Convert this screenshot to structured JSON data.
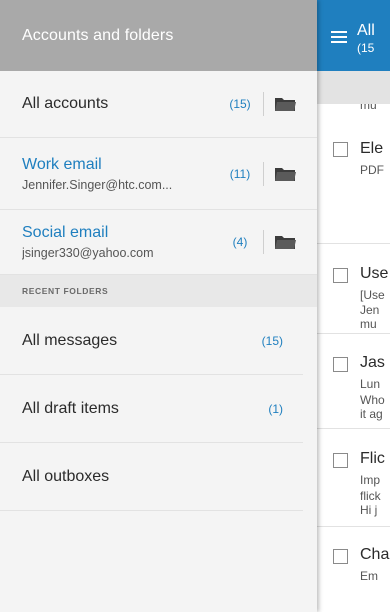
{
  "drawer": {
    "title": "Accounts and folders",
    "accounts": [
      {
        "name": "All accounts",
        "email": "",
        "count": "(15)"
      },
      {
        "name": "Work email",
        "email": "Jennifer.Singer@htc.com...",
        "count": "(11)"
      },
      {
        "name": "Social email",
        "email": "jsinger330@yahoo.com",
        "count": "(4)"
      }
    ],
    "recent_header": "RECENT FOLDERS",
    "folders": [
      {
        "name": "All messages",
        "count": "(15)"
      },
      {
        "name": "All draft items",
        "count": "(1)"
      },
      {
        "name": "All outboxes",
        "count": ""
      }
    ]
  },
  "mail": {
    "title": "All",
    "subtitle": "(15",
    "strip_text": "mu",
    "items": [
      {
        "title": "Ele",
        "lines": [
          "PDF"
        ]
      },
      {
        "title": "Use",
        "lines": [
          "[Use",
          "Jen",
          "mu"
        ]
      },
      {
        "title": "Jas",
        "lines": [
          "Lun",
          "Who",
          "it ag"
        ]
      },
      {
        "title": "Flic",
        "lines": [
          "Imp",
          "flick",
          "Hi j"
        ]
      },
      {
        "title": "Cha",
        "lines": [
          "Em"
        ]
      }
    ]
  },
  "colors": {
    "accent": "#1f7fbf",
    "drawer_header": "#a9a9a9"
  }
}
